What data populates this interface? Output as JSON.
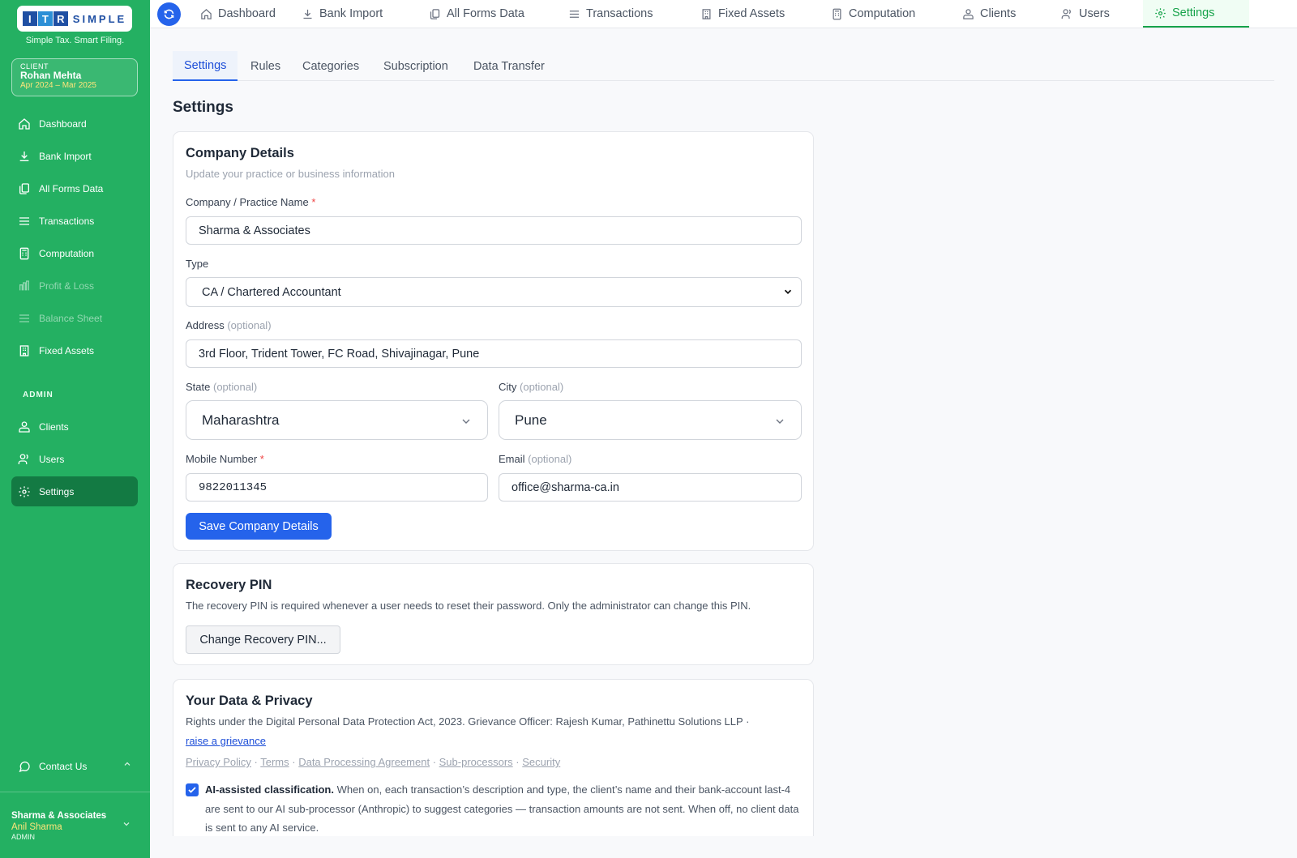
{
  "sidebar": {
    "logo": {
      "letters": [
        "I",
        "T",
        "R"
      ],
      "word": "SIMPLE"
    },
    "tagline": "Simple Tax. Smart Filing.",
    "client": {
      "label": "CLIENT",
      "name": "Rohan Mehta",
      "period": "Apr 2024 – Mar 2025"
    },
    "items": [
      {
        "label": "Dashboard",
        "icon": "home-icon",
        "state": "normal"
      },
      {
        "label": "Bank Import",
        "icon": "download-icon",
        "state": "normal"
      },
      {
        "label": "All Forms Data",
        "icon": "documents-icon",
        "state": "normal"
      },
      {
        "label": "Transactions",
        "icon": "list-icon",
        "state": "normal"
      },
      {
        "label": "Computation",
        "icon": "calculator-icon",
        "state": "normal"
      },
      {
        "label": "Profit & Loss",
        "icon": "bar-chart-icon",
        "state": "disabled"
      },
      {
        "label": "Balance Sheet",
        "icon": "scale-icon",
        "state": "disabled"
      },
      {
        "label": "Fixed Assets",
        "icon": "building-icon",
        "state": "normal"
      }
    ],
    "admin_label": "ADMIN",
    "admin_items": [
      {
        "label": "Clients",
        "icon": "clients-icon",
        "state": "normal"
      },
      {
        "label": "Users",
        "icon": "users-icon",
        "state": "normal"
      },
      {
        "label": "Settings",
        "icon": "gear-icon",
        "state": "active"
      }
    ],
    "contact": "Contact Us",
    "user": {
      "company": "Sharma & Associates",
      "name": "Anil Sharma",
      "role": "ADMIN"
    }
  },
  "topnav": {
    "items": [
      {
        "label": "Dashboard",
        "icon": "home-icon"
      },
      {
        "label": "Bank Import",
        "icon": "download-icon"
      },
      {
        "label": "All Forms Data",
        "icon": "documents-icon"
      },
      {
        "label": "Transactions",
        "icon": "list-icon"
      },
      {
        "label": "Fixed Assets",
        "icon": "building-icon"
      },
      {
        "label": "Computation",
        "icon": "calculator-icon"
      },
      {
        "label": "Clients",
        "icon": "clients-icon"
      },
      {
        "label": "Users",
        "icon": "users-icon"
      },
      {
        "label": "Settings",
        "icon": "gear-icon",
        "active": true
      }
    ]
  },
  "subtabs": [
    "Settings",
    "Rules",
    "Categories",
    "Subscription",
    "Data Transfer"
  ],
  "page_title": "Settings",
  "company": {
    "title": "Company Details",
    "subtitle": "Update your practice or business information",
    "name_label": "Company / Practice Name",
    "name_value": "Sharma & Associates",
    "type_label": "Type",
    "type_value": "CA / Chartered Accountant",
    "address_label": "Address",
    "address_value": "3rd Floor, Trident Tower, FC Road, Shivajinagar, Pune",
    "state_label": "State",
    "state_value": "Maharashtra",
    "city_label": "City",
    "city_value": "Pune",
    "mobile_label": "Mobile Number",
    "mobile_value": "9822011345",
    "email_label": "Email",
    "email_value": "office@sharma-ca.in",
    "optional": "(optional)",
    "required_mark": "*",
    "save_label": "Save Company Details"
  },
  "recovery": {
    "title": "Recovery PIN",
    "description": "The recovery PIN is required whenever a user needs to reset their password. Only the administrator can change this PIN.",
    "button": "Change Recovery PIN..."
  },
  "privacy": {
    "title": "Your Data & Privacy",
    "rights_text": "Rights under the Digital Personal Data Protection Act, 2023. Grievance Officer: Rajesh Kumar, Pathinettu Solutions LLP ·",
    "grievance_link": "raise a grievance",
    "links": [
      "Privacy Policy",
      "Terms",
      "Data Processing Agreement",
      "Sub-processors",
      "Security"
    ],
    "link_separator": " · ",
    "ai_title": "AI-assisted classification.",
    "ai_text": "When on, each transaction’s description and type, the client’s name and their bank-account last-4 are sent to our AI sub-processor (Anthropic) to suggest categories — transaction amounts are not sent. When off, no client data is sent to any AI service.",
    "ai_checked": true
  },
  "colors": {
    "sidebar": "#24b062",
    "sidebar_active": "#137a43",
    "primary": "#2563eb",
    "nav_active": "#16a34a",
    "client_period": "#ffe57a"
  }
}
